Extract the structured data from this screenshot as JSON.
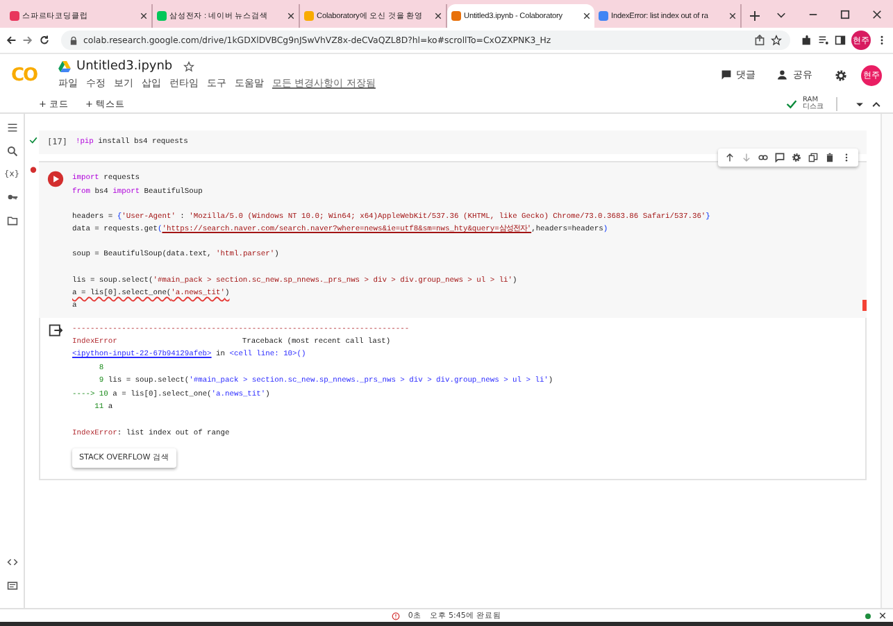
{
  "browser": {
    "tabs": [
      {
        "title": "스파르타코딩클럽",
        "selected": false,
        "color": "#e8365d"
      },
      {
        "title": "삼성전자 : 네이버 뉴스검색",
        "selected": false,
        "color": "#03c75a"
      },
      {
        "title": "Colaboratory에 오신 것을 환영",
        "selected": false,
        "color": "#f9ab00"
      },
      {
        "title": "Untitled3.ipynb - Colaboratory",
        "selected": true,
        "color": "#e8710a"
      },
      {
        "title": "IndexError: list index out of ra",
        "selected": false,
        "color": "#4285f4"
      }
    ],
    "address": "colab.research.google.com/drive/1kGDXlDVBCg9nJSwVhVZ8x-deCVaQZL8D?hl=ko#scrollTo=CxOZXPNK3_Hz",
    "profile": "현주"
  },
  "colab": {
    "logo": "CO",
    "file_name": "Untitled3.ipynb",
    "menu": [
      "파일",
      "수정",
      "보기",
      "삽입",
      "런타임",
      "도구",
      "도움말"
    ],
    "save_status": "모든 변경사항이 저장됨",
    "comment": "댓글",
    "share": "공유",
    "avatar": "현주",
    "add_buttons": [
      "+ 코드",
      "+ 텍스트"
    ],
    "ram": "RAM",
    "disk": "디스크",
    "variables": "{x}"
  },
  "cells": [
    {
      "count": "[17]",
      "error": false,
      "code": [
        [
          [
            {
              "kind": "kw",
              "text": "!pip"
            },
            {
              "kind": "plain",
              "text": " install bs4 requests"
            }
          ]
        ]
      ]
    },
    {
      "error": true,
      "code": [
        [
          [
            {
              "kind": "kw",
              "text": "import"
            },
            {
              "kind": "plain",
              "text": " requests"
            }
          ],
          [
            {
              "kind": "kw",
              "text": "from"
            },
            {
              "kind": "plain",
              "text": " bs4 "
            },
            {
              "kind": "kw",
              "text": "import"
            },
            {
              "kind": "plain",
              "text": " BeautifulSoup"
            }
          ]
        ],
        [
          [
            {
              "kind": "plain",
              "text": "headers = "
            },
            {
              "kind": "punct",
              "text": "{"
            },
            {
              "kind": "str",
              "text": "'User-Agent'"
            },
            {
              "kind": "plain",
              "text": " : "
            },
            {
              "kind": "str",
              "text": "'Mozilla/5.0 (Windows NT 10.0; Win64; x64)AppleWebKit/537.36 (KHTML, like Gecko) Chrome/73.0.3683.86 Safari/537.36'"
            },
            {
              "kind": "punct",
              "text": "}"
            }
          ],
          [
            {
              "kind": "plain",
              "text": "data = requests.get"
            },
            {
              "kind": "punct",
              "text": "("
            },
            {
              "kind": "link",
              "text": "'https://search.naver.com/search.naver?where=news&ie=utf8&sm=nws_hty&query=삼성전자'"
            },
            {
              "kind": "plain",
              "text": ",headers=headers"
            },
            {
              "kind": "punct",
              "text": ")"
            }
          ]
        ],
        [
          [
            {
              "kind": "plain",
              "text": "soup = BeautifulSoup(data.text, "
            },
            {
              "kind": "str",
              "text": "'html.parser'"
            },
            {
              "kind": "plain",
              "text": ")"
            }
          ]
        ],
        [
          [
            {
              "kind": "plain",
              "text": "lis = soup.select("
            },
            {
              "kind": "str",
              "text": "'#main_pack > section.sc_new.sp_nnews._prs_nws > div > div.group_news > ul > li'"
            },
            {
              "kind": "plain",
              "text": ")"
            }
          ],
          [
            {
              "kind": "lint",
              "text": "a = lis[0].select_one("
            },
            {
              "kind": "lintstr",
              "text": "'a.news_tit'"
            },
            {
              "kind": "lint",
              "text": ")"
            }
          ],
          [
            {
              "kind": "plain",
              "text": "a"
            }
          ]
        ]
      ],
      "output": [
        [
          [
            {
              "kind": "err",
              "text": "---------------------------------------------------------------------------"
            }
          ],
          [
            {
              "kind": "err",
              "text": "IndexError"
            },
            {
              "kind": "tab",
              "text": "Traceback (most recent call last)"
            }
          ],
          [
            {
              "kind": "link",
              "text": "<ipython-input-22-67b94129afeb>"
            },
            {
              "kind": "plain",
              "text": " in "
            },
            {
              "kind": "blue",
              "text": "<cell line: 10>()"
            }
          ],
          [
            {
              "kind": "num",
              "text": "      8"
            }
          ],
          [
            {
              "kind": "num",
              "text": "      9 "
            },
            {
              "kind": "plain",
              "text": "lis = soup.select("
            },
            {
              "kind": "blue",
              "text": "'#main_pack > section.sc_new.sp_nnews._prs_nws > div > div.group_news > ul > li'"
            },
            {
              "kind": "plain",
              "text": ")"
            }
          ],
          [
            {
              "kind": "num",
              "text": "----> 10 "
            },
            {
              "kind": "plain",
              "text": "a = lis[0].select_one("
            },
            {
              "kind": "blue",
              "text": "'a.news_tit'"
            },
            {
              "kind": "plain",
              "text": ")"
            }
          ],
          [
            {
              "kind": "num",
              "text": "     11 "
            },
            {
              "kind": "plain",
              "text": "a"
            }
          ]
        ],
        [
          [
            {
              "kind": "err",
              "text": "IndexError"
            },
            {
              "kind": "plain",
              "text": ": list index out of range"
            }
          ]
        ]
      ],
      "search_button": "STACK OVERFLOW 검색"
    }
  ],
  "status_bar": {
    "duration": "0초",
    "finished": "오후 5:45에 완료됨"
  }
}
